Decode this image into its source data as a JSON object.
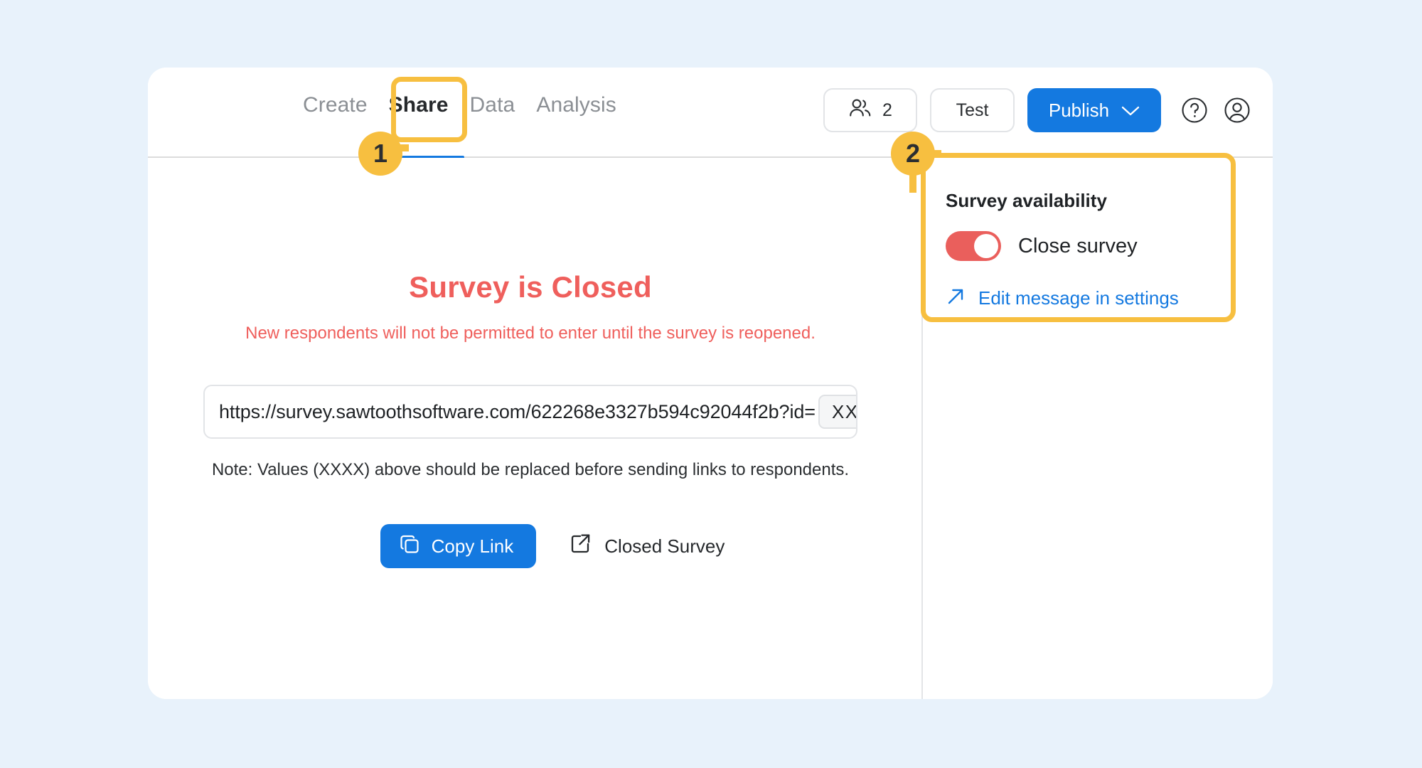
{
  "window": {
    "background_color": "#e8f2fb",
    "card_background": "#ffffff"
  },
  "header": {
    "tabs": [
      {
        "label": "Create",
        "active": false
      },
      {
        "label": "Share",
        "active": true
      },
      {
        "label": "Data",
        "active": false
      },
      {
        "label": "Analysis",
        "active": false
      }
    ],
    "active_tab_underline_color": "#1479e0",
    "respondents": {
      "icon": "people-icon",
      "count": "2"
    },
    "test_label": "Test",
    "publish_label": "Publish",
    "publish_chevron": "chevron-down-icon",
    "publish_color": "#1479e0",
    "help_icon": "help-circle-icon",
    "account_icon": "user-circle-icon"
  },
  "preview": {
    "title": "Survey is Closed",
    "title_color": "#ef5f5c",
    "subtitle": "New respondents will not be permitted to enter until the survey is reopened.",
    "url_prefix": "https://survey.sawtoothsoftware.com/622268e3327b594c92044f2b?id=",
    "url_token": "XXXX",
    "url_suffix": "&",
    "hint": "Note: Values (XXXX) above should be replaced before sending links to respondents.",
    "copy_link_label": "Copy Link",
    "copy_link_icon": "copy-icon",
    "closed_survey_label": "Closed Survey",
    "closed_survey_icon": "external-link-icon"
  },
  "right_panel": {
    "title": "Survey availability",
    "toggle": {
      "label": "Close survey",
      "state": "on",
      "color": "#ea5f5c"
    },
    "edit_link": {
      "label": "Edit message in settings",
      "icon": "arrow-up-right-icon",
      "color": "#1479e0"
    }
  },
  "annotations": {
    "accent_color": "#f7bf40",
    "markers": [
      {
        "number": "1",
        "target": "share-tab"
      },
      {
        "number": "2",
        "target": "survey-availability-panel"
      }
    ]
  }
}
